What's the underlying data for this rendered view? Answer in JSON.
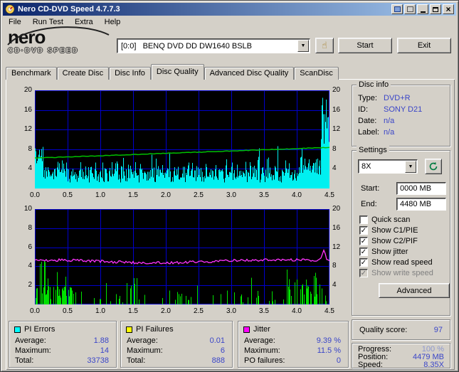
{
  "window": {
    "title": "Nero CD-DVD Speed 4.7.7.3"
  },
  "icons": {
    "close": "×",
    "dropdown": "▼",
    "hand": "☝",
    "check": "✓"
  },
  "menu": {
    "items": [
      "File",
      "Run Test",
      "Extra",
      "Help"
    ]
  },
  "logo": {
    "line1": "nero",
    "line2": "CD·DVD SPEED"
  },
  "header": {
    "drive_value": "[0:0]   BENQ DVD DD DW1640 BSLB",
    "start_label": "Start",
    "exit_label": "Exit"
  },
  "tabs": {
    "items": [
      "Benchmark",
      "Create Disc",
      "Disc Info",
      "Disc Quality",
      "Advanced Disc Quality",
      "ScanDisc"
    ],
    "active_index": 3
  },
  "disc_info": {
    "title": "Disc info",
    "rows": [
      {
        "label": "Type:",
        "value": "DVD+R"
      },
      {
        "label": "ID:",
        "value": "SONY D21"
      },
      {
        "label": "Date:",
        "value": "n/a"
      },
      {
        "label": "Label:",
        "value": "n/a"
      }
    ]
  },
  "settings": {
    "title": "Settings",
    "speed": "8X",
    "start_label": "Start:",
    "start_value": "0000 MB",
    "end_label": "End:",
    "end_value": "4480 MB",
    "checkboxes": [
      {
        "label": "Quick scan",
        "checked": false,
        "disabled": false
      },
      {
        "label": "Show C1/PIE",
        "checked": true,
        "disabled": false
      },
      {
        "label": "Show C2/PIF",
        "checked": true,
        "disabled": false
      },
      {
        "label": "Show jitter",
        "checked": true,
        "disabled": false
      },
      {
        "label": "Show read speed",
        "checked": true,
        "disabled": false
      },
      {
        "label": "Show write speed",
        "checked": true,
        "disabled": true
      }
    ],
    "advanced_label": "Advanced"
  },
  "quality": {
    "label": "Quality score:",
    "value": "97"
  },
  "progress": {
    "rows": [
      {
        "label": "Progress:",
        "value": "100 %"
      },
      {
        "label": "Position:",
        "value": "4479 MB"
      },
      {
        "label": "Speed:",
        "value": "8.35X"
      }
    ]
  },
  "stats": [
    {
      "title": "PI Errors",
      "color": "#00ffff",
      "rows": [
        [
          "Average:",
          "1.88"
        ],
        [
          "Maximum:",
          "14"
        ],
        [
          "Total:",
          "33738"
        ]
      ]
    },
    {
      "title": "PI Failures",
      "color": "#ffff00",
      "rows": [
        [
          "Average:",
          "0.01"
        ],
        [
          "Maximum:",
          "6"
        ],
        [
          "Total:",
          "888"
        ]
      ]
    },
    {
      "title": "Jitter",
      "color": "#ff00ff",
      "rows": [
        [
          "Average:",
          "9.39 %"
        ],
        [
          "Maximum:",
          "11.5 %"
        ],
        [
          "PO failures:",
          "0"
        ]
      ]
    }
  ],
  "ui_colors": {
    "value_text": "#3a45c8",
    "titlebar_start": "#0a246a",
    "titlebar_end": "#a6caf0"
  },
  "charts": {
    "x_axis": {
      "ticks": [
        "0.0",
        "0.5",
        "1.0",
        "1.5",
        "2.0",
        "2.5",
        "3.0",
        "3.5",
        "4.0",
        "4.5"
      ],
      "min": 0,
      "max": 4.5
    },
    "grid_color": "#0000cc",
    "plot_bg": "#000000",
    "top": {
      "seed": 1337,
      "left_axis": {
        "min": 0,
        "max": 20,
        "ticks": [
          20,
          16,
          12,
          8,
          4
        ]
      },
      "right_axis": {
        "min": 0,
        "max": 20,
        "ticks": [
          20,
          16,
          12,
          8,
          4
        ]
      },
      "series": [
        {
          "name": "pi-errors",
          "type": "spikes",
          "color": "#00f0f0",
          "axis": "left",
          "average": 1.88,
          "maximum": 14
        },
        {
          "name": "read-speed",
          "type": "line",
          "color": "#00c000",
          "axis": "right",
          "start_value": 6.2,
          "end_value": 8.35
        }
      ]
    },
    "bottom": {
      "seed": 7331,
      "left_axis": {
        "min": 0,
        "max": 10,
        "ticks": [
          10,
          8,
          6,
          4,
          2
        ]
      },
      "right_axis": {
        "min": 0,
        "max": 20,
        "ticks": [
          20,
          16,
          12,
          8,
          4
        ]
      },
      "series": [
        {
          "name": "pi-failures",
          "type": "spikes",
          "color": "#00e000",
          "axis": "left",
          "average": 0.01,
          "maximum": 6
        },
        {
          "name": "jitter",
          "type": "line",
          "color": "#ff33ff",
          "axis": "right",
          "average": 9.39,
          "maximum": 11.5
        }
      ]
    }
  }
}
